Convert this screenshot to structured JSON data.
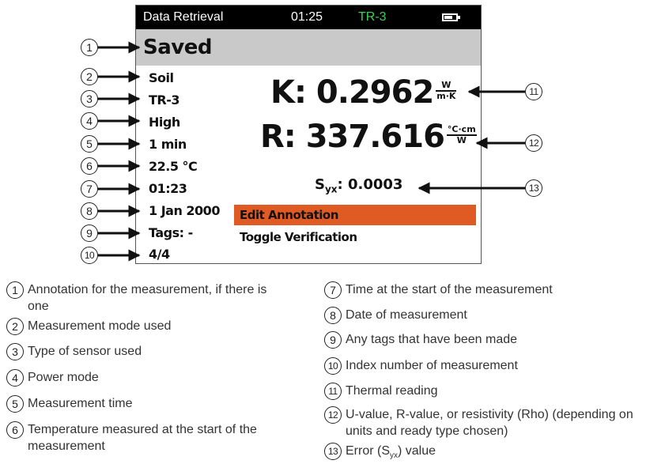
{
  "screen": {
    "status_title": "Data Retrieval",
    "status_time": "01:25",
    "status_sensor": "TR-3",
    "battery_level": 0.7,
    "saved_label": "Saved",
    "fields": [
      "Soil",
      "TR-3",
      "High",
      "1 min",
      "22.5 °C",
      "01:23",
      "1 Jan 2000",
      "Tags: -",
      "4/4"
    ],
    "k_prefix": "K: 0.2962",
    "k_unit_num": "W",
    "k_unit_den": "m·K",
    "r_prefix": "R: 337.616",
    "r_unit_num": "°C·cm",
    "r_unit_den": "W",
    "syx_s": "S",
    "syx_sub": "yx",
    "syx_value": ": 0.0003",
    "edit_annotation": "Edit Annotation",
    "toggle_verification": "Toggle Verification"
  },
  "callout_numbers": [
    "1",
    "2",
    "3",
    "4",
    "5",
    "6",
    "7",
    "8",
    "9",
    "10",
    "11",
    "12",
    "13"
  ],
  "legend": {
    "items": [
      {
        "num": "1",
        "text": "Annotation for the measurement, if there is one"
      },
      {
        "num": "2",
        "text": "Measurement mode used"
      },
      {
        "num": "3",
        "text": "Type of sensor used"
      },
      {
        "num": "4",
        "text": "Power mode"
      },
      {
        "num": "5",
        "text": "Measurement time"
      },
      {
        "num": "6",
        "text": "Temperature measured at the start of the measurement"
      },
      {
        "num": "7",
        "text": "Time at the start of the measurement"
      },
      {
        "num": "8",
        "text": "Date of measurement"
      },
      {
        "num": "9",
        "text": "Any tags that have been made"
      },
      {
        "num": "10",
        "text": "Index number of measurement"
      },
      {
        "num": "11",
        "text": "Thermal reading"
      },
      {
        "num": "12",
        "text": "U-value, R-value, or resistivity (Rho) (depending on units and ready type chosen)"
      },
      {
        "num": "13a",
        "text": "Error (S"
      },
      {
        "num": "13b",
        "text": "yx"
      },
      {
        "num": "13c",
        "text": ") value"
      }
    ]
  }
}
